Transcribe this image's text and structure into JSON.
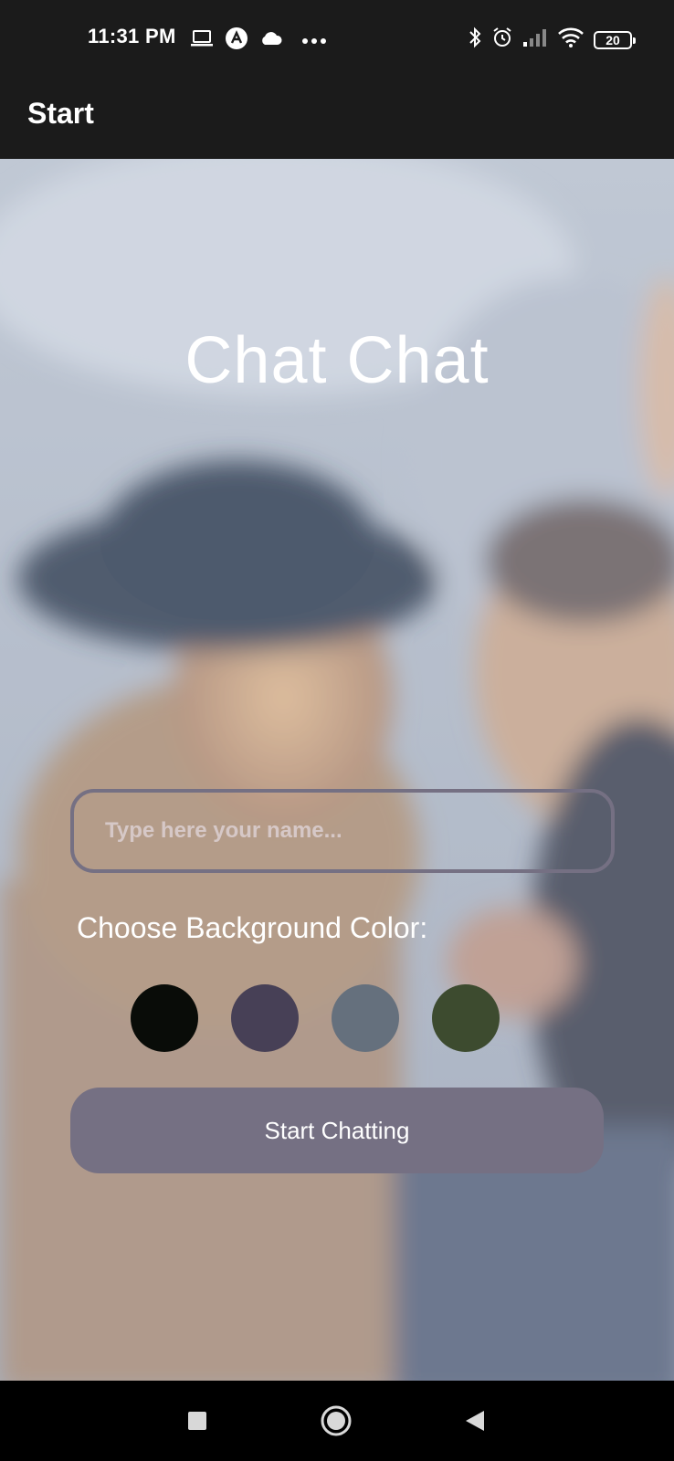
{
  "status_bar": {
    "time": "11:31 PM",
    "left_icons": [
      "laptop-icon",
      "app-logo-icon",
      "cloud-icon",
      "more-dots-icon"
    ],
    "right_icons": [
      "bluetooth-icon",
      "alarm-icon",
      "signal-icon",
      "wifi-icon"
    ],
    "battery_level": "20"
  },
  "app_bar": {
    "title": "Start"
  },
  "main": {
    "title": "Chat Chat",
    "name_input": {
      "value": "",
      "placeholder": "Type here your name..."
    },
    "color_label": "Choose Background Color:",
    "color_options": [
      {
        "name": "black",
        "hex": "#090C08"
      },
      {
        "name": "purple",
        "hex": "#474056"
      },
      {
        "name": "grey",
        "hex": "#65707D"
      },
      {
        "name": "green",
        "hex": "#3D4B2F"
      }
    ],
    "start_button": "Start Chatting"
  },
  "colors": {
    "bar_background": "#1b1b1b",
    "accent": "#757083",
    "nav_background": "#000000"
  },
  "nav_bar": {
    "buttons": [
      "recents-square-icon",
      "home-circle-icon",
      "back-triangle-icon"
    ]
  }
}
